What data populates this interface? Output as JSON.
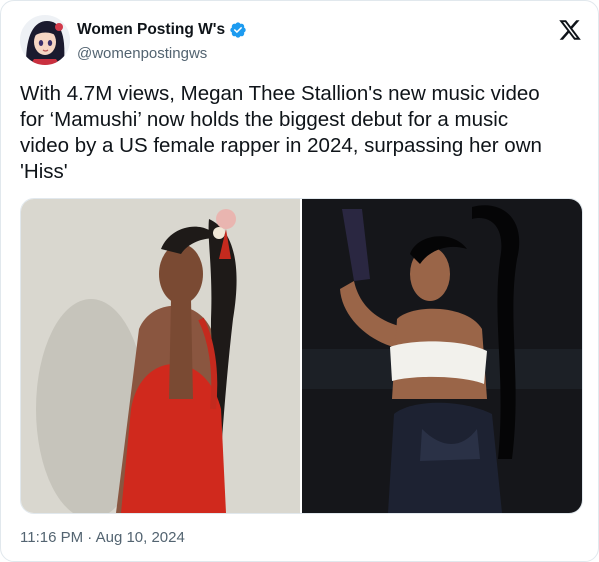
{
  "author": {
    "display_name": "Women Posting W's",
    "handle": "@womenpostingws",
    "verified": true,
    "avatar_icon": "anime-profile-avatar"
  },
  "platform_icon": "x-logo-icon",
  "tweet": {
    "text": "With 4.7M views, Megan Thee Stallion's new music video\nfor ‘Mamushi’ now holds the biggest debut for a music\nvideo by a US female rapper in 2024, surpassing her own\n'Hiss'"
  },
  "media": [
    {
      "description_icon": "photo-red-dress",
      "background": "#d9d7cf"
    },
    {
      "description_icon": "photo-white-top",
      "background": "#15161a"
    }
  ],
  "timestamp": "11:16 PM · Aug 10, 2024",
  "colors": {
    "text_primary": "#0f1419",
    "text_secondary": "#536471",
    "verified_blue": "#1d9bf0",
    "border": "#e1e8ed"
  }
}
